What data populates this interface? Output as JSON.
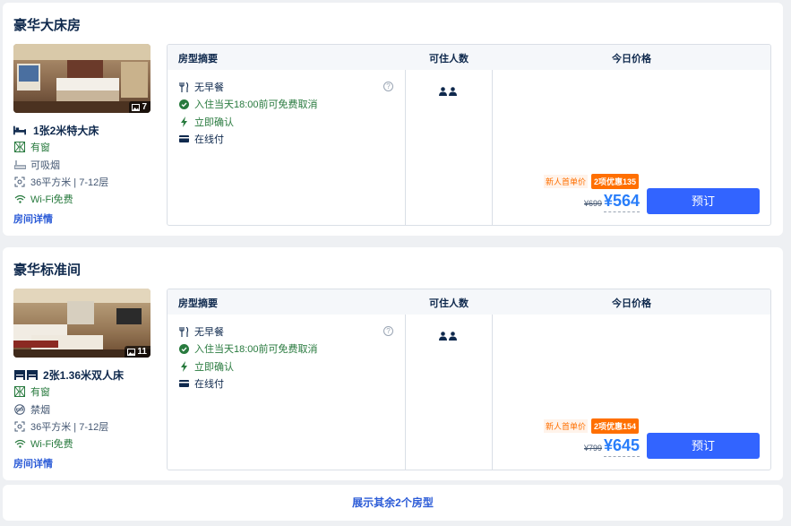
{
  "rooms": [
    {
      "title": "豪华大床房",
      "photo_count": "7",
      "bed": "1张2米特大床",
      "window": "有窗",
      "smoking": "可吸烟",
      "area_floor": "36平方米 | 7-12层",
      "wifi": "Wi-Fi免费",
      "detail_link": "房间详情",
      "table_headers": {
        "summary": "房型摘要",
        "occupancy": "可住人数",
        "price": "今日价格"
      },
      "features": {
        "breakfast": "无早餐",
        "cancel": "入住当天18:00前可免费取消",
        "confirm": "立即确认",
        "payment": "在线付"
      },
      "help_icon": "?",
      "promo_label": "新人首单价",
      "coupon": "2项优惠135",
      "original_price": "¥699",
      "price": "¥564",
      "book_label": "预订"
    },
    {
      "title": "豪华标准间",
      "photo_count": "11",
      "bed": "2张1.36米双人床",
      "window": "有窗",
      "smoking": "禁烟",
      "area_floor": "36平方米 | 7-12层",
      "wifi": "Wi-Fi免费",
      "detail_link": "房间详情",
      "table_headers": {
        "summary": "房型摘要",
        "occupancy": "可住人数",
        "price": "今日价格"
      },
      "features": {
        "breakfast": "无早餐",
        "cancel": "入住当天18:00前可免费取消",
        "confirm": "立即确认",
        "payment": "在线付"
      },
      "help_icon": "?",
      "promo_label": "新人首单价",
      "coupon": "2项优惠154",
      "original_price": "¥799",
      "price": "¥645",
      "book_label": "预订"
    }
  ],
  "show_more": "展示其余2个房型",
  "colors": {
    "accent": "#3264ff",
    "price": "#287dfa",
    "green": "#287a3e",
    "orange": "#ff6f00",
    "link": "#2b5bd7"
  }
}
